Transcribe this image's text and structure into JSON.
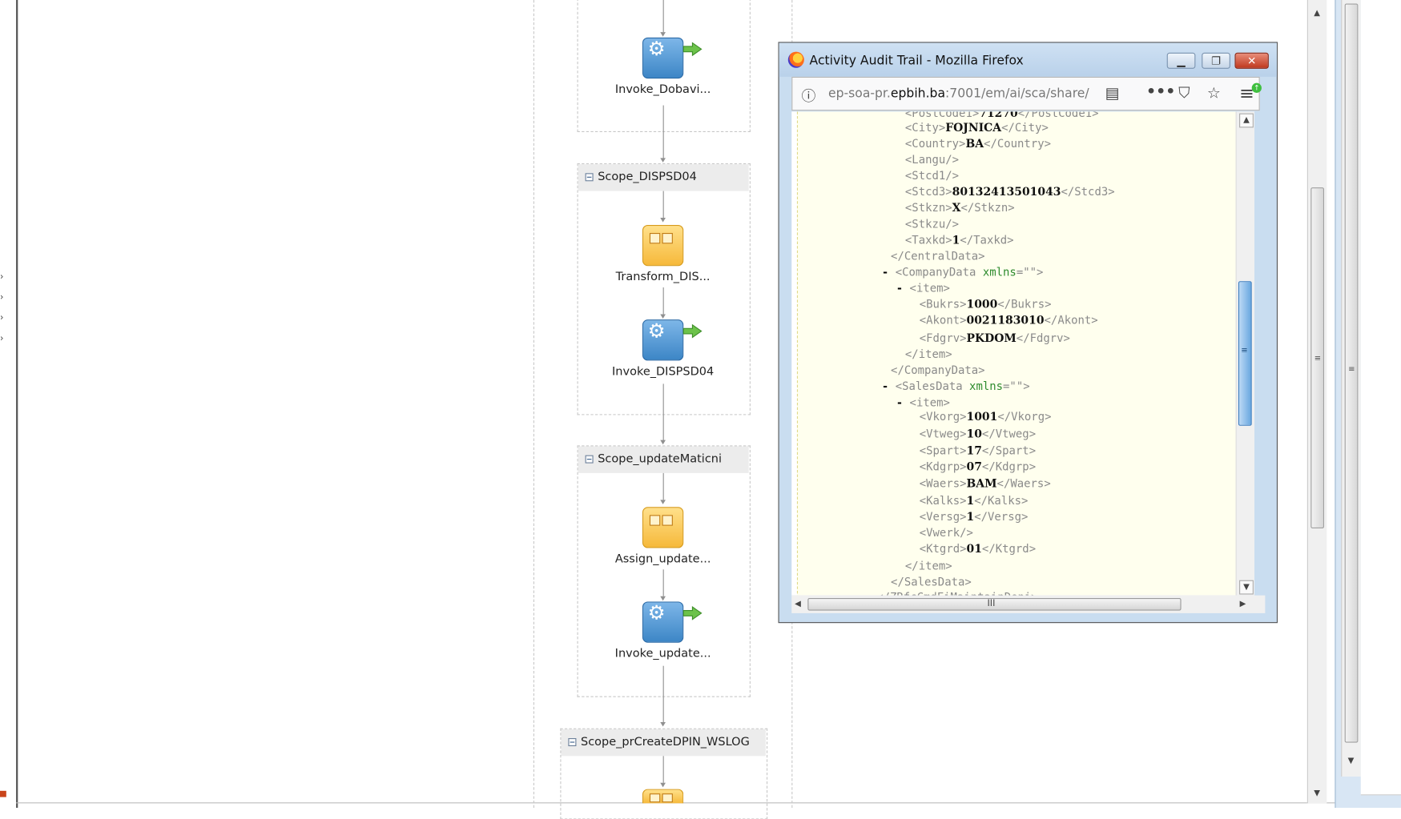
{
  "diagram": {
    "nodes": {
      "invoke_dobavi": "Invoke_Dobavi...",
      "scope_dispsd04": "Scope_DISPSD04",
      "transform_dis": "Transform_DIS...",
      "invoke_dispsd04": "Invoke_DISPSD04",
      "scope_updatematicni": "Scope_updateMaticni",
      "assign_update": "Assign_update...",
      "invoke_update": "Invoke_update...",
      "scope_prcreatedpin": "Scope_prCreateDPIN_WSLOG"
    }
  },
  "popup": {
    "title": "Activity Audit Trail - Mozilla Firefox",
    "url_prefix": "ep-soa-pr.",
    "url_domain": "epbih.ba",
    "url_rest": ":7001/em/ai/sca/share/",
    "scrollbar_label": "III"
  },
  "xml": {
    "l_city_open": "<City>",
    "l_city_val": "FOJNICA",
    "l_city_close": "</City>",
    "l_country_open": "<Country>",
    "l_country_val": "BA",
    "l_country_close": "</Country>",
    "l_langu": "<Langu/>",
    "l_stcd1": "<Stcd1/>",
    "l_stcd3_open": "<Stcd3>",
    "l_stcd3_val": "80132413501043",
    "l_stcd3_close": "</Stcd3>",
    "l_stkzn_open": "<Stkzn>",
    "l_stkzn_val": "X",
    "l_stkzn_close": "</Stkzn>",
    "l_stkzu": "<Stkzu/>",
    "l_taxkd_open": "<Taxkd>",
    "l_taxkd_val": "1",
    "l_taxkd_close": "</Taxkd>",
    "l_centraldata_close": "</CentralData>",
    "l_companydata_open": "<CompanyData",
    "l_xmlns": "xmlns",
    "l_xmlns_val": "=\"\">",
    "l_item_open": "<item>",
    "l_bukrs_open": "<Bukrs>",
    "l_bukrs_val": "1000",
    "l_bukrs_close": "</Bukrs>",
    "l_akont_open": "<Akont>",
    "l_akont_val": "0021183010",
    "l_akont_close": "</Akont>",
    "l_fdgrv_open": "<Fdgrv>",
    "l_fdgrv_val": "PKDOM",
    "l_fdgrv_close": "</Fdgrv>",
    "l_item_close": "</item>",
    "l_companydata_close": "</CompanyData>",
    "l_salesdata_open": "<SalesData",
    "l_vkorg_open": "<Vkorg>",
    "l_vkorg_val": "1001",
    "l_vkorg_close": "</Vkorg>",
    "l_vtweg_open": "<Vtweg>",
    "l_vtweg_val": "10",
    "l_vtweg_close": "</Vtweg>",
    "l_spart_open": "<Spart>",
    "l_spart_val": "17",
    "l_spart_close": "</Spart>",
    "l_kdgrp_open": "<Kdgrp>",
    "l_kdgrp_val": "07",
    "l_kdgrp_close": "</Kdgrp>",
    "l_waers_open": "<Waers>",
    "l_waers_val": "BAM",
    "l_waers_close": "</Waers>",
    "l_kalks_open": "<Kalks>",
    "l_kalks_val": "1",
    "l_kalks_close": "</Kalks>",
    "l_versg_open": "<Versg>",
    "l_versg_val": "1",
    "l_versg_close": "</Versg>",
    "l_vwerk": "<Vwerk/>",
    "l_ktgrd_open": "<Ktgrd>",
    "l_ktgrd_val": "01",
    "l_ktgrd_close": "</Ktgrd>",
    "l_salesdata_close": "</SalesData>"
  }
}
